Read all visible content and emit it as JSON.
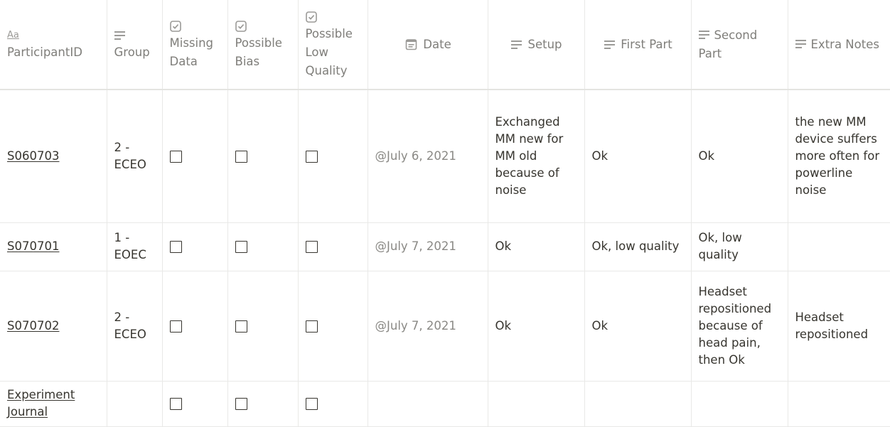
{
  "columns": [
    {
      "key": "participant_id",
      "icon": "title-aa-icon",
      "icon_text": "Aa",
      "label": "ParticipantID"
    },
    {
      "key": "group",
      "icon": "text-lines-icon",
      "label": "Group"
    },
    {
      "key": "missing_data",
      "icon": "checkbox-property-icon",
      "label": "Missing Data"
    },
    {
      "key": "possible_bias",
      "icon": "checkbox-property-icon",
      "label": "Possible Bias"
    },
    {
      "key": "possible_low_quality",
      "icon": "checkbox-property-icon",
      "label": "Possible Low Quality"
    },
    {
      "key": "date",
      "icon": "calendar-icon",
      "label": "Date"
    },
    {
      "key": "setup",
      "icon": "text-lines-icon",
      "label": "Setup"
    },
    {
      "key": "first_part",
      "icon": "text-lines-icon",
      "label": "First Part"
    },
    {
      "key": "second_part",
      "icon": "text-lines-icon",
      "label": "Second Part"
    },
    {
      "key": "extra_notes",
      "icon": "text-lines-icon",
      "label": "Extra Notes"
    }
  ],
  "rows": [
    {
      "participant_id": "S060703",
      "group": "2 - ECEO",
      "missing_data": false,
      "possible_bias": false,
      "possible_low_quality": false,
      "date": "@July 6, 2021",
      "setup": "Exchanged MM new for MM old because of noise",
      "first_part": "Ok",
      "second_part": "Ok",
      "extra_notes": "the new MM device suffers more often for powerline noise"
    },
    {
      "participant_id": "S070701",
      "group": "1 - EOEC",
      "missing_data": false,
      "possible_bias": false,
      "possible_low_quality": false,
      "date": "@July 7, 2021",
      "setup": "Ok",
      "first_part": "Ok, low quality",
      "second_part": "Ok, low quality",
      "extra_notes": ""
    },
    {
      "participant_id": "S070702",
      "group": "2 - ECEO",
      "missing_data": false,
      "possible_bias": false,
      "possible_low_quality": false,
      "date": "@July 7, 2021",
      "setup": "Ok",
      "first_part": "Ok",
      "second_part": "Headset repositioned because of head pain, then Ok",
      "extra_notes": "Headset repositioned"
    },
    {
      "participant_id": "Experiment Journal",
      "group": "",
      "missing_data": false,
      "possible_bias": false,
      "possible_low_quality": false,
      "date": "",
      "setup": "",
      "first_part": "",
      "second_part": "",
      "extra_notes": ""
    }
  ]
}
